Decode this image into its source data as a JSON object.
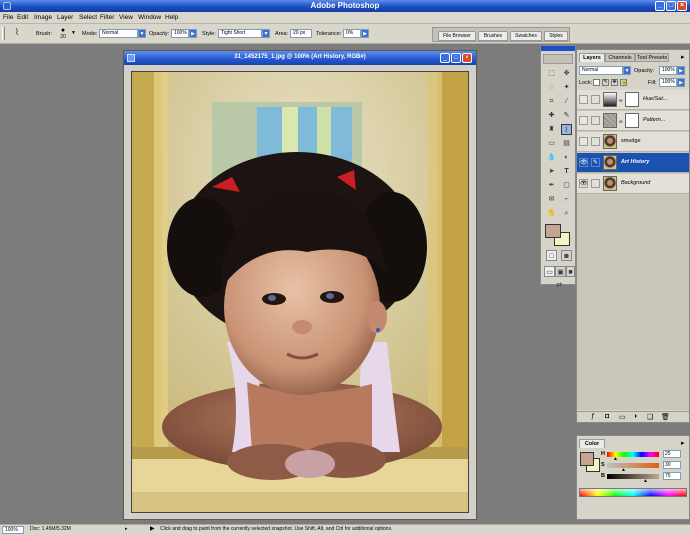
{
  "app": {
    "title": "Adobe Photoshop"
  },
  "menu": [
    "File",
    "Edit",
    "Image",
    "Layer",
    "Select",
    "Filter",
    "View",
    "Window",
    "Help"
  ],
  "options": {
    "brush_label": "Brush:",
    "brush_size": "20",
    "mode_label": "Mode:",
    "mode_value": "Normal",
    "opacity_label": "Opacity:",
    "opacity_value": "100%",
    "style_label": "Style:",
    "style_value": "Tight Short",
    "area_label": "Area:",
    "area_value": "20 px",
    "tolerance_label": "Tolerance:",
    "tolerance_value": "0%"
  },
  "palette_well": [
    "File Browser",
    "Brushes",
    "Swatches",
    "Styles"
  ],
  "document": {
    "title": "31_1452175_1.jpg @ 100% (Art History, RGB#)",
    "image_icon": "photo-portrait"
  },
  "layers_palette": {
    "tabs": [
      "Layers",
      "Channels",
      "Tool Presets"
    ],
    "blend_mode": "Normal",
    "opacity_label": "Opacity:",
    "opacity_value": "100%",
    "lock_label": "Lock:",
    "fill_label": "Fill:",
    "fill_value": "100%",
    "layers": [
      {
        "name": "Hue/Sat...",
        "visible": false,
        "selected": false,
        "thumb": "adjustment"
      },
      {
        "name": "Pattern...",
        "visible": false,
        "selected": false,
        "thumb": "pattern"
      },
      {
        "name": "smudge",
        "visible": false,
        "selected": false,
        "thumb": "photo"
      },
      {
        "name": "Art History",
        "visible": true,
        "selected": true,
        "thumb": "photo"
      },
      {
        "name": "Background",
        "visible": true,
        "selected": false,
        "thumb": "photo"
      }
    ]
  },
  "color_palette": {
    "tab": "Color",
    "h_label": "H",
    "h_value": "25",
    "s_label": "S",
    "s_value": "30",
    "b_label": "B",
    "b_value": "75",
    "foreground": "#c4a58f",
    "background": "#f7f2c4"
  },
  "status": {
    "zoom": "100%",
    "doc": "Doc: 1.45M/5.32M",
    "hint": "Click and drag to paint from the currently selected snapshot. Use Shift, Alt, and Ctrl for additional options."
  }
}
